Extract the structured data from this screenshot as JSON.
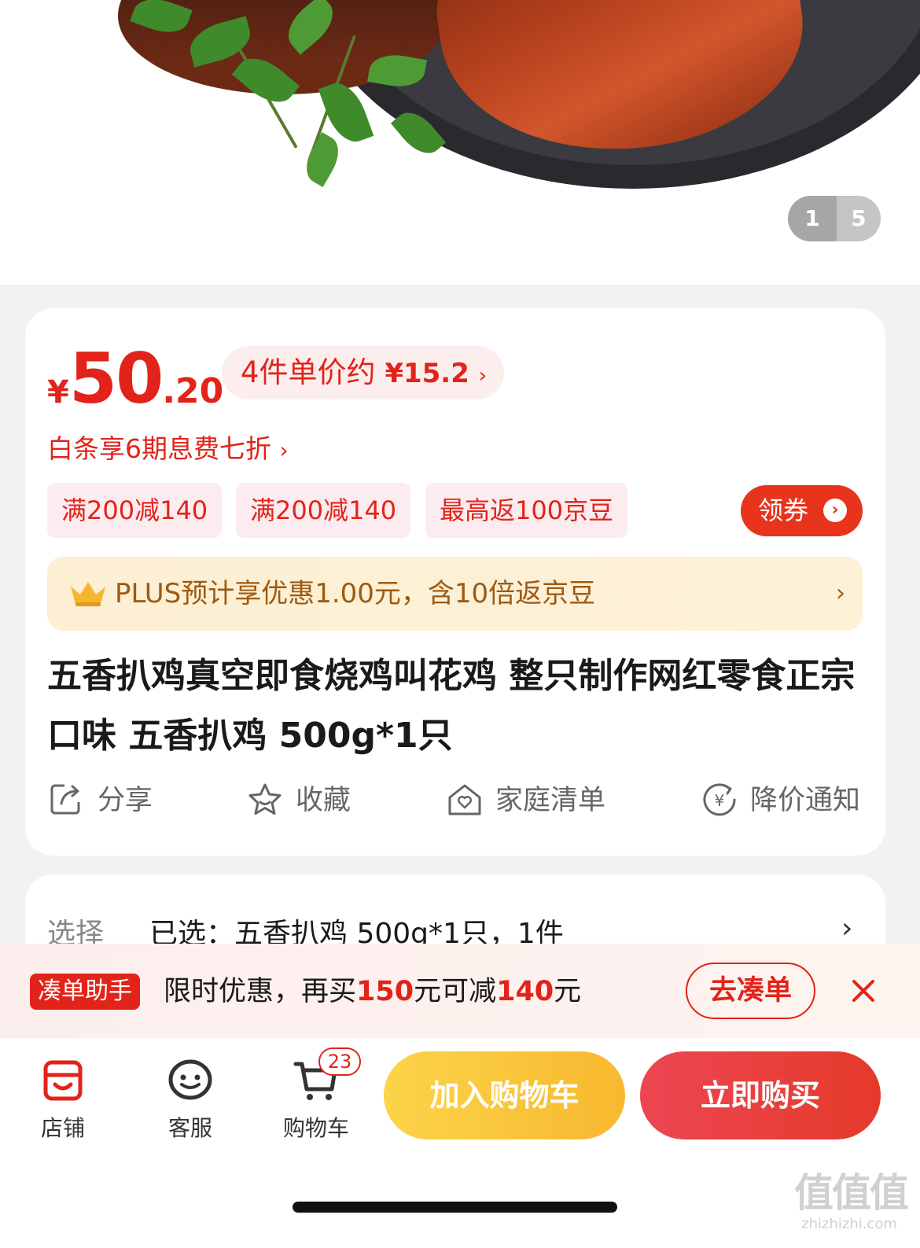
{
  "gallery": {
    "current": "1",
    "total": "5"
  },
  "price": {
    "currency": "¥",
    "integer": "50",
    "decimal": ".20"
  },
  "unit_price": {
    "prefix": "4件单价约",
    "value": "¥15.2",
    "chevron": "›"
  },
  "baitiao": {
    "text": "白条享6期息费七折",
    "chevron": "›"
  },
  "promo_tags": [
    "满200减140",
    "满200减140",
    "最高返100京豆"
  ],
  "coupon_button": {
    "label": "领券",
    "arrow": "›"
  },
  "plus": {
    "text": "PLUS预计享优惠1.00元，含10倍返京豆",
    "chevron": "›"
  },
  "product_title": "五香扒鸡真空即食烧鸡叫花鸡 整只制作网红零食正宗口味 五香扒鸡 500g*1只",
  "actions": [
    {
      "label": "分享",
      "icon": "share-icon"
    },
    {
      "label": "收藏",
      "icon": "star-icon"
    },
    {
      "label": "家庭清单",
      "icon": "home-heart-icon"
    },
    {
      "label": "降价通知",
      "icon": "price-drop-icon"
    }
  ],
  "selection": {
    "label": "选择",
    "value": "已选：五香扒鸡 500g*1只，1件",
    "chevron": "›"
  },
  "helper": {
    "badge": "凑单助手",
    "text_before": "限时优惠，再买",
    "amount": "150",
    "text_middle": "元可减",
    "discount": "140",
    "text_after": "元",
    "button": "去凑单"
  },
  "bottom_nav": [
    {
      "label": "店铺",
      "icon": "store-icon"
    },
    {
      "label": "客服",
      "icon": "service-icon"
    },
    {
      "label": "购物车",
      "icon": "cart-icon",
      "badge": "23"
    }
  ],
  "add_to_cart": "加入购物车",
  "buy_now": "立即购买",
  "watermark": {
    "main": "值值值",
    "sub": "zhizhizhi.com"
  },
  "colors": {
    "accent": "#e2231a",
    "cart_button": "#f7b82f",
    "buy_button": "#e53a2a",
    "plus_text": "#9c5a12"
  }
}
